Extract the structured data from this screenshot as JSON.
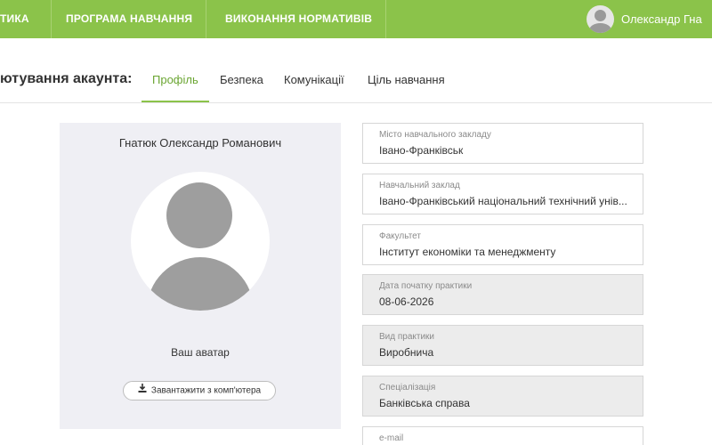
{
  "nav": {
    "items": [
      {
        "label": "ТИКА"
      },
      {
        "label": "ПРОГРАМА НАВЧАННЯ"
      },
      {
        "label": "ВИКОНАННЯ НОРМАТИВІВ"
      }
    ],
    "user_name": "Олександр Гна",
    "accent_color": "#8bc34a"
  },
  "settings": {
    "title": "ютування акаунта:",
    "tabs": [
      {
        "label": "Профіль",
        "active": true
      },
      {
        "label": "Безпека",
        "active": false
      },
      {
        "label": "Комунікації",
        "active": false
      },
      {
        "label": "Ціль навчання",
        "active": false
      }
    ]
  },
  "profile": {
    "full_name": "Гнатюк Олександр Романович",
    "avatar_caption": "Ваш аватар",
    "upload_label": "Завантажити з комп'ютера",
    "upload_icon": "download-icon"
  },
  "fields": [
    {
      "label": "Місто навчального закладу",
      "value": "Івано-Франківськ",
      "readonly": false
    },
    {
      "label": "Навчальний заклад",
      "value": "Івано-Франківський національний технічний унів...",
      "readonly": false
    },
    {
      "label": "Факультет",
      "value": "Інститут економіки та менеджменту",
      "readonly": false
    },
    {
      "label": "Дата початку практики",
      "value": "08-06-2026",
      "readonly": true
    },
    {
      "label": "Вид практики",
      "value": "Виробнича",
      "readonly": true
    },
    {
      "label": "Спеціалізація",
      "value": "Банківська справа",
      "readonly": true
    },
    {
      "label": "e-mail",
      "value": "",
      "readonly": false
    }
  ]
}
